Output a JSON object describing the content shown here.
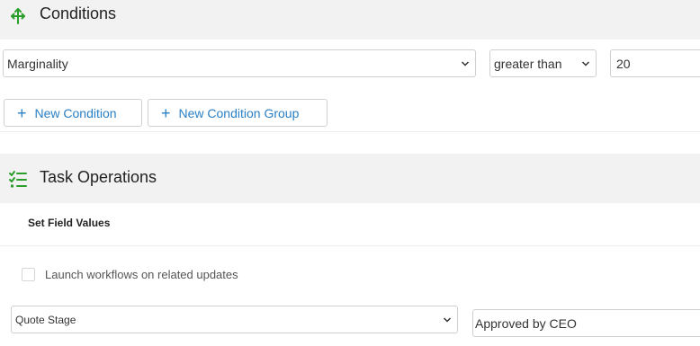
{
  "conditions": {
    "title": "Conditions",
    "icon": "branch-arrows-icon",
    "field_select": "Marginality",
    "operator_select": "greater than",
    "value_input": "20",
    "new_condition_label": "New Condition",
    "new_condition_group_label": "New Condition Group"
  },
  "task_operations": {
    "title": "Task Operations",
    "icon": "checklist-icon",
    "set_field_values_label": "Set Field Values",
    "launch_workflows_label": "Launch workflows on related updates",
    "launch_workflows_checked": false,
    "field_select": "Quote Stage",
    "value_input": "Approved by CEO"
  },
  "colors": {
    "accent_green": "#2a9d2a",
    "link_blue": "#2a7fc4",
    "header_bg": "#f2f2f2"
  }
}
